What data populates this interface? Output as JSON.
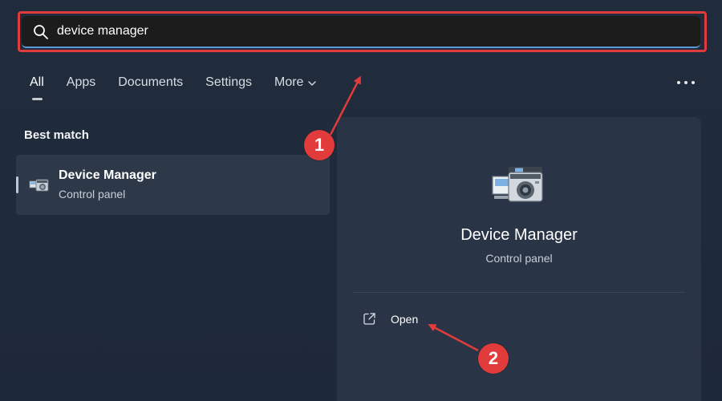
{
  "search": {
    "value": "device manager",
    "placeholder": ""
  },
  "tabs": [
    {
      "label": "All",
      "active": true
    },
    {
      "label": "Apps",
      "active": false
    },
    {
      "label": "Documents",
      "active": false
    },
    {
      "label": "Settings",
      "active": false
    },
    {
      "label": "More",
      "active": false
    }
  ],
  "best_match": {
    "section_title": "Best match",
    "item": {
      "title": "Device Manager",
      "subtitle": "Control panel",
      "icon": "device-manager-icon"
    }
  },
  "preview": {
    "title": "Device Manager",
    "subtitle": "Control panel",
    "icon": "device-manager-icon",
    "actions": [
      {
        "label": "Open",
        "icon": "open-external-icon"
      }
    ]
  },
  "annotations": {
    "step_1": "1",
    "step_2": "2",
    "highlight_color": "#e23b3b"
  },
  "colors": {
    "accent": "#5e9ad8",
    "annotation": "#e23b3b"
  }
}
